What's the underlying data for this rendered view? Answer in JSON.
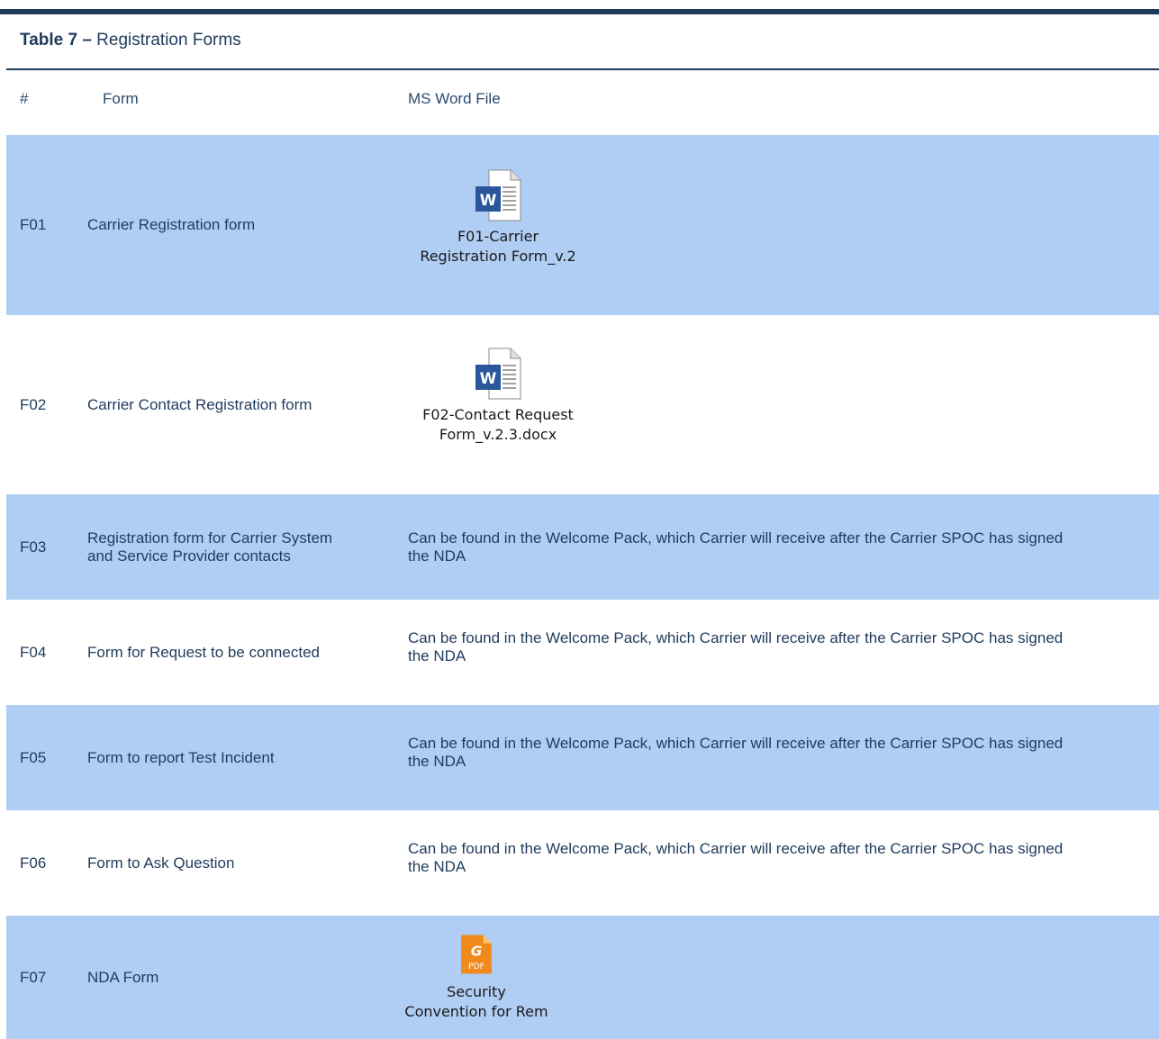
{
  "caption": {
    "prefix": "Table 7 –",
    "title": " Registration Forms"
  },
  "header": {
    "num": "#",
    "form": "Form",
    "file": "MS Word File"
  },
  "rows": [
    {
      "id": "F01",
      "form": "Carrier Registration form",
      "icon": "word-doc-icon",
      "file_lines": [
        "F01-Carrier",
        "Registration Form_v.2"
      ]
    },
    {
      "id": "F02",
      "form": "Carrier Contact Registration form",
      "icon": "word-doc-icon",
      "file_lines": [
        "F02-Contact Request",
        "Form_v.2.3.docx"
      ]
    },
    {
      "id": "F03",
      "form_lines": [
        "Registration form for Carrier System",
        "and Service Provider contacts"
      ],
      "file_text_lines": [
        "Can be found in the Welcome Pack, which Carrier will receive after the Carrier SPOC has signed",
        "the NDA"
      ]
    },
    {
      "id": "F04",
      "form": "Form for Request to be connected",
      "file_text_lines": [
        "Can be found in the Welcome Pack, which Carrier will receive after the Carrier SPOC has signed",
        "the NDA"
      ]
    },
    {
      "id": "F05",
      "form": "Form to report Test Incident",
      "file_text_lines": [
        "Can be found in the Welcome Pack, which Carrier will receive after the Carrier SPOC has signed",
        "the NDA"
      ]
    },
    {
      "id": "F06",
      "form": "Form to Ask Question",
      "file_text_lines": [
        "Can be found in the Welcome Pack, which Carrier will receive after the Carrier SPOC has signed",
        "the NDA"
      ]
    },
    {
      "id": "F07",
      "form": "NDA Form",
      "icon": "pdf-doc-icon",
      "pdf_label": "PDF",
      "file_lines": [
        "Security",
        "Convention for Rem"
      ]
    }
  ],
  "colors": {
    "header_rule": "#1f3b5c",
    "shaded_row": "#b0cdf3",
    "text": "#1f3b5c",
    "word_blue": "#2b579a",
    "pdf_orange": "#f08a1c"
  }
}
